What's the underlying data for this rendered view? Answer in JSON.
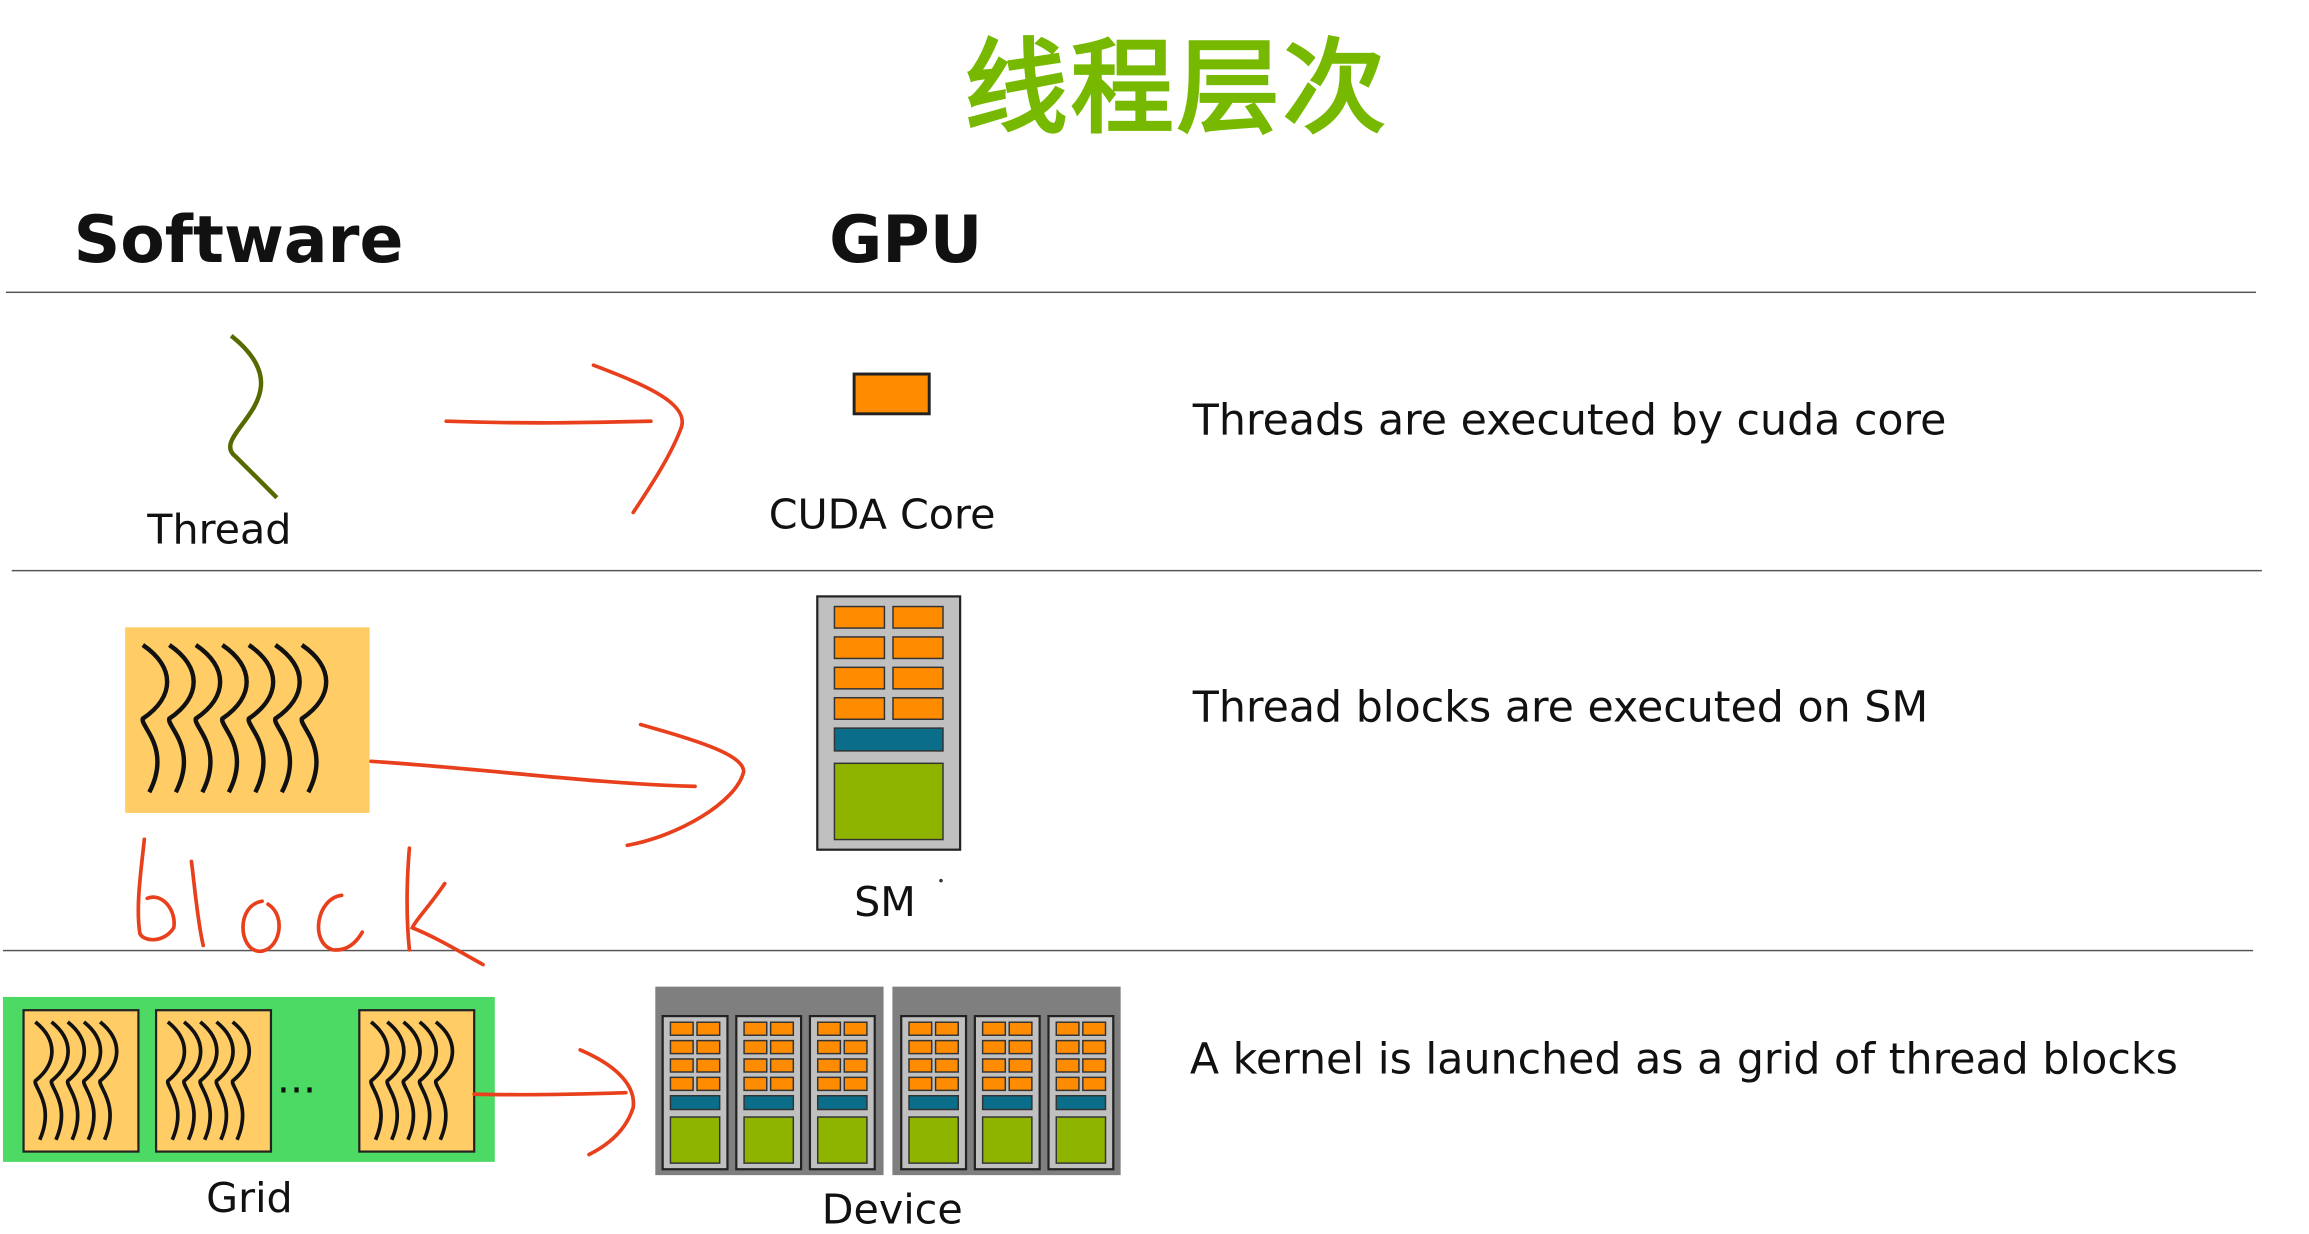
{
  "title": "线程层次",
  "headers": {
    "software": "Software",
    "gpu": "GPU"
  },
  "rows": [
    {
      "software_label": "Thread",
      "gpu_label": "CUDA Core",
      "description": "Threads are executed by cuda core"
    },
    {
      "software_label": "",
      "gpu_label": "SM",
      "description": "Thread blocks are executed on SM"
    },
    {
      "software_label": "Grid",
      "gpu_label": "Device",
      "description": "A kernel is launched as a grid of thread blocks"
    }
  ],
  "handwritten_annotation": "block",
  "grid_ellipsis": "...",
  "colors": {
    "title_green": "#76b900",
    "cuda_core_orange": "#ff8c00",
    "block_fill": "#ffcc66",
    "grid_green": "#4cd964",
    "sm_gray": "#c0c0c0",
    "device_gray": "#7f7f7f",
    "teal": "#0a6e8a",
    "lime": "#8fb400",
    "annotation_red": "#e8401c",
    "thread_olive": "#556b00"
  },
  "icons": [
    "thread-squiggle-icon",
    "cuda-core-icon",
    "thread-block-icon",
    "sm-icon",
    "grid-icon",
    "device-icon"
  ]
}
